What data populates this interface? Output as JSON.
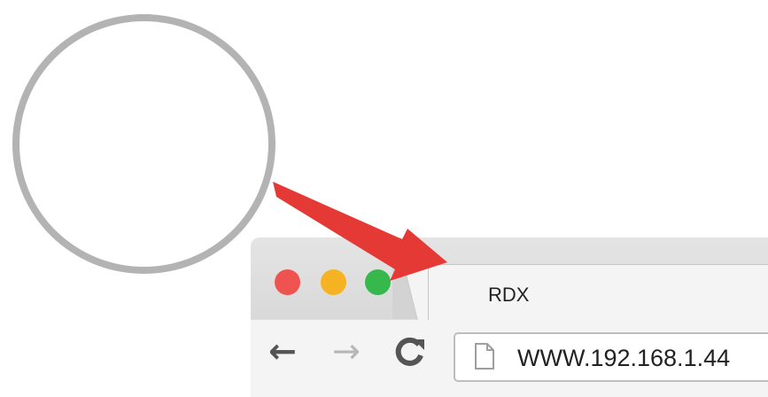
{
  "browser": {
    "window_controls": {
      "close": "close-traffic-light",
      "minimize": "minimize-traffic-light",
      "maximize": "maximize-traffic-light"
    },
    "tab": {
      "title": "RDX"
    },
    "toolbar": {
      "back_icon": "←",
      "forward_icon": "→",
      "reload_icon": "C",
      "address": {
        "value": "WWW.192.168.1.44",
        "icon": "page-icon"
      }
    }
  },
  "annotation": {
    "circle_color": "#b3b3b3",
    "arrow_color": "#e53935"
  },
  "colors": {
    "close": "#ef5350",
    "minimize": "#f5b324",
    "maximize": "#37b84c"
  }
}
